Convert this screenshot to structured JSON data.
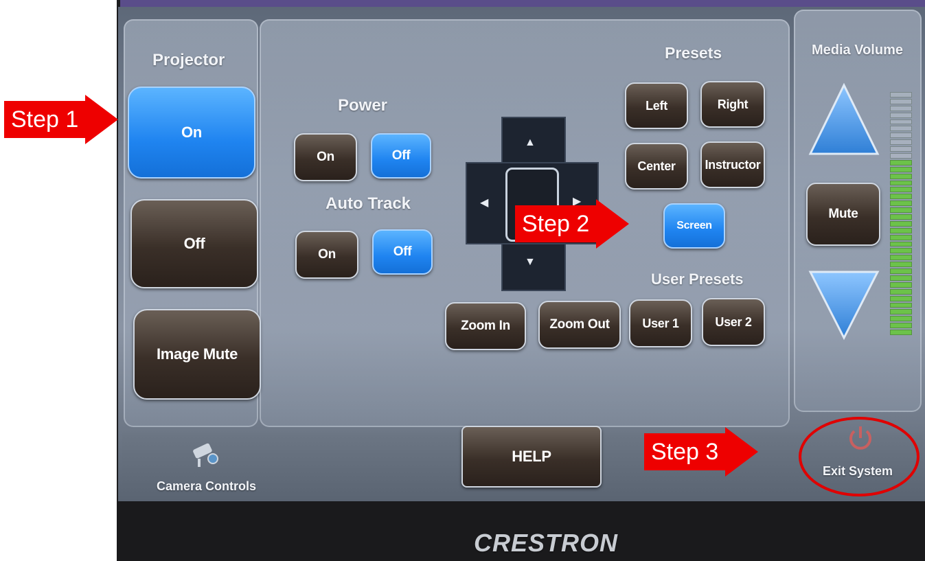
{
  "projector": {
    "title": "Projector",
    "on": "On",
    "off": "Off",
    "image_mute": "Image Mute"
  },
  "power": {
    "title": "Power",
    "on": "On",
    "off": "Off"
  },
  "auto_track": {
    "title": "Auto Track",
    "on": "On",
    "off": "Off"
  },
  "presets": {
    "title": "Presets",
    "left": "Left",
    "right": "Right",
    "center": "Center",
    "instructor": "Instructor",
    "screen": "Screen"
  },
  "user_presets": {
    "title": "User Presets",
    "user1": "User 1",
    "user2": "User 2"
  },
  "zoom": {
    "in": "Zoom In",
    "out": "Zoom Out"
  },
  "volume": {
    "title": "Media Volume",
    "mute": "Mute",
    "level_fraction": 0.72
  },
  "bottom_bar": {
    "camera_controls": "Camera Controls",
    "help": "HELP",
    "exit_system": "Exit System"
  },
  "brand": "CRESTRON",
  "annotations": {
    "step1": "Step 1",
    "step2": "Step 2",
    "step3": "Step 3"
  },
  "colors": {
    "active_blue": "#1f84f0",
    "annotation_red": "#ee0000"
  },
  "icons": [
    "camera-icon",
    "power-icon",
    "arrow-up-icon",
    "arrow-down-icon",
    "arrow-left-icon",
    "arrow-right-icon",
    "volume-up-icon",
    "volume-down-icon"
  ]
}
